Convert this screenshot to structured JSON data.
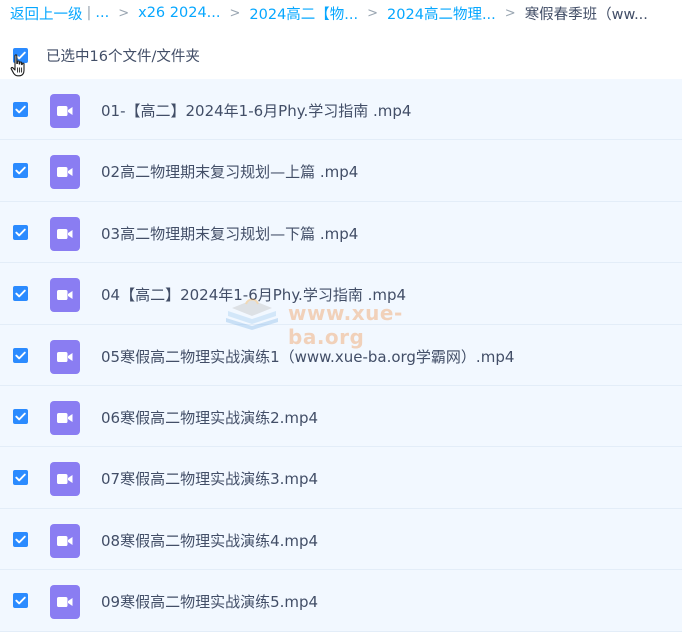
{
  "breadcrumb": {
    "back": "返回上一级",
    "pipe": "|",
    "dots": "...",
    "separator": ">",
    "items": [
      "x26 2024...",
      "2024高二【物...",
      "2024高二物理...",
      "寒假春季班（ww..."
    ]
  },
  "selection": {
    "summary": "已选中16个文件/文件夹"
  },
  "files": [
    {
      "name": "01-【高二】2024年1-6月Phy.学习指南 .mp4"
    },
    {
      "name": "02高二物理期末复习规划—上篇 .mp4"
    },
    {
      "name": "03高二物理期末复习规划—下篇 .mp4"
    },
    {
      "name": "04【高二】2024年1-6月Phy.学习指南 .mp4"
    },
    {
      "name": "05寒假高二物理实战演练1（www.xue-ba.org学霸网）.mp4"
    },
    {
      "name": "06寒假高二物理实战演练2.mp4"
    },
    {
      "name": "07寒假高二物理实战演练3.mp4"
    },
    {
      "name": "08寒假高二物理实战演练4.mp4"
    },
    {
      "name": "09寒假高二物理实战演练5.mp4"
    }
  ],
  "watermark": {
    "text": "www.xue-ba.org"
  },
  "colors": {
    "accent": "#06a7ff",
    "checkbox": "#2b8bff",
    "video_icon": "#8a7df2",
    "row_selected_bg": "#f2f8ff",
    "text": "#424e67"
  },
  "icons": {
    "checkbox": "checkbox-checked-icon",
    "file": "video-file-icon",
    "cursor": "hand-pointer-icon"
  }
}
